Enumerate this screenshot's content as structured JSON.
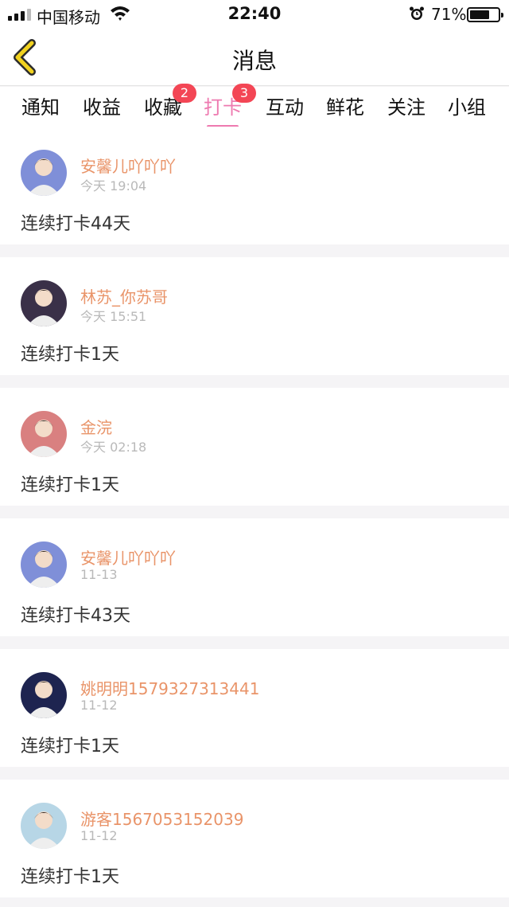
{
  "status_bar": {
    "carrier": "中国移动",
    "time": "22:40",
    "battery_percent": "71%",
    "battery_level": 0.71
  },
  "nav": {
    "title": "消息"
  },
  "tabs": [
    {
      "label": "通知",
      "badge": ""
    },
    {
      "label": "收益",
      "badge": ""
    },
    {
      "label": "收藏",
      "badge": "2"
    },
    {
      "label": "打卡",
      "badge": "3",
      "active": true
    },
    {
      "label": "互动",
      "badge": ""
    },
    {
      "label": "鲜花",
      "badge": ""
    },
    {
      "label": "关注",
      "badge": ""
    },
    {
      "label": "小组",
      "badge": ""
    }
  ],
  "messages": [
    {
      "username": "安馨儿吖吖吖",
      "time": "今天 19:04",
      "text": "连续打卡44天",
      "avatar_color": "#7f8fd8"
    },
    {
      "username": "林苏_你苏哥",
      "time": "今天 15:51",
      "text": "连续打卡1天",
      "avatar_color": "#3a3048"
    },
    {
      "username": "金浣",
      "time": "今天 02:18",
      "text": "连续打卡1天",
      "avatar_color": "#d98080"
    },
    {
      "username": "安馨儿吖吖吖",
      "time": "11-13",
      "text": "连续打卡43天",
      "avatar_color": "#7f8fd8"
    },
    {
      "username": "姚明明1579327313441",
      "time": "11-12",
      "text": "连续打卡1天",
      "avatar_color": "#1e2450"
    },
    {
      "username": "游客1567053152039",
      "time": "11-12",
      "text": "连续打卡1天",
      "avatar_color": "#b7d6e6"
    }
  ],
  "colors": {
    "accent_pink": "#ee7ab0",
    "username_orange": "#e99469",
    "badge_red": "#f34655",
    "back_arrow_yellow": "#f1d21f"
  }
}
